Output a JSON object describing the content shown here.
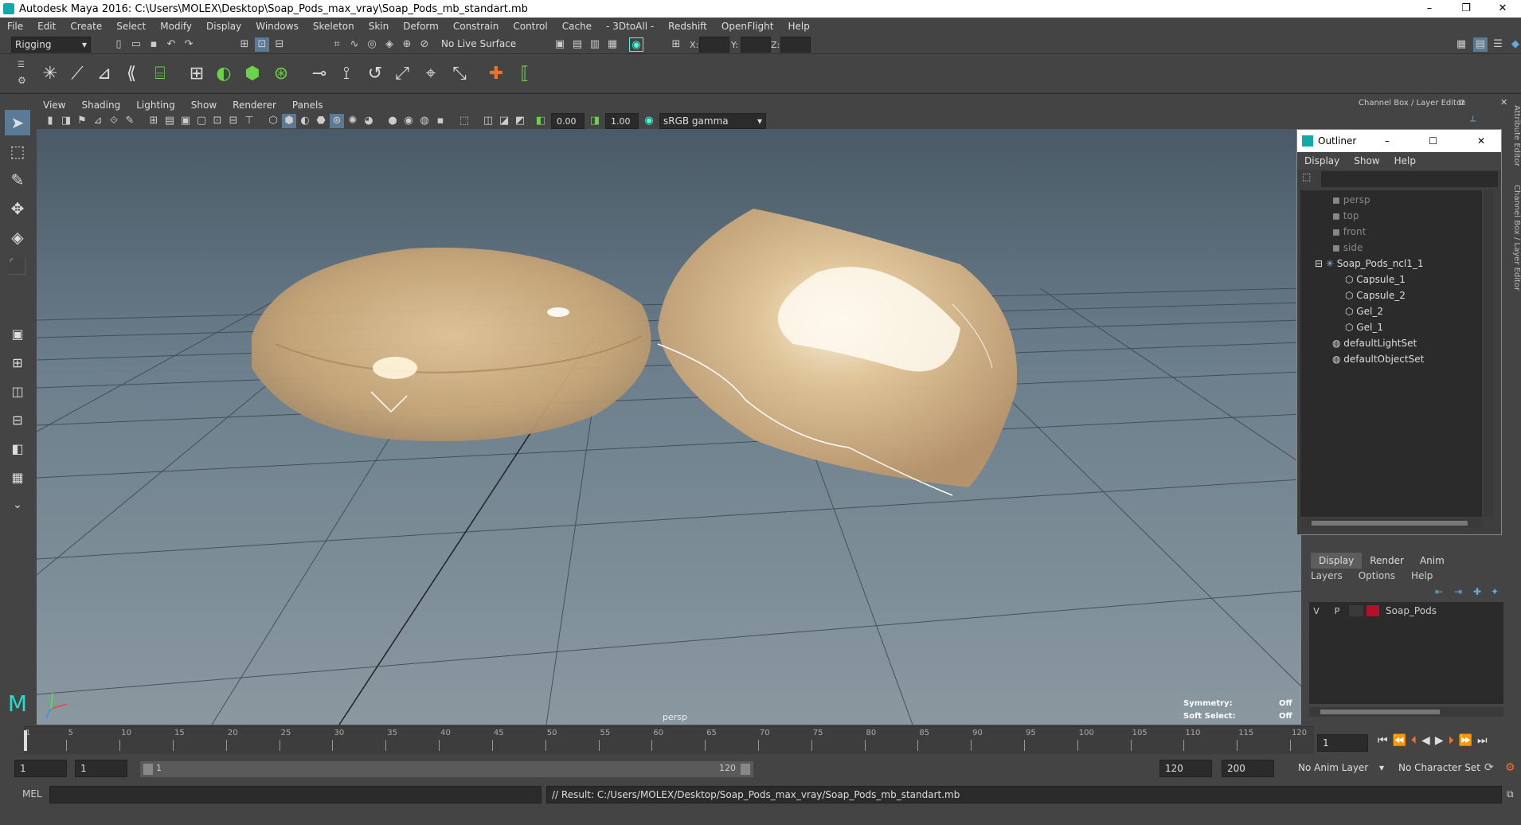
{
  "window": {
    "title": "Autodesk Maya 2016: C:\\Users\\MOLEX\\Desktop\\Soap_Pods_max_vray\\Soap_Pods_mb_standart.mb",
    "min": "–",
    "restore": "❐",
    "close": "✕"
  },
  "menubar": [
    "File",
    "Edit",
    "Create",
    "Select",
    "Modify",
    "Display",
    "Windows",
    "Skeleton",
    "Skin",
    "Deform",
    "Constrain",
    "Control",
    "Cache",
    "- 3DtoAll -",
    "Redshift",
    "OpenFlight",
    "Help"
  ],
  "statusline": {
    "mode": "Rigging",
    "live_surface": "No Live Surface",
    "x_label": "X:",
    "y_label": "Y:",
    "z_label": "Z:"
  },
  "viewport": {
    "menu": [
      "View",
      "Shading",
      "Lighting",
      "Show",
      "Renderer",
      "Panels"
    ],
    "exposure": "0.00",
    "gamma": "1.00",
    "colorspace": "sRGB gamma",
    "camera_label": "persp",
    "symmetry_label": "Symmetry:",
    "symmetry_value": "Off",
    "softselect_label": "Soft Select:",
    "softselect_value": "Off"
  },
  "channelbox": {
    "title": "Channel Box / Layer Editor",
    "side_tab_1": "Attribute Editor",
    "side_tab_2": "Channel Box / Layer Editor"
  },
  "outliner": {
    "title": "Outliner",
    "menu": [
      "Display",
      "Show",
      "Help"
    ],
    "items": [
      {
        "label": "persp",
        "dim": true
      },
      {
        "label": "top",
        "dim": true
      },
      {
        "label": "front",
        "dim": true
      },
      {
        "label": "side",
        "dim": true
      },
      {
        "label": "Soap_Pods_ncl1_1",
        "dim": false
      },
      {
        "label": "Capsule_1",
        "dim": false
      },
      {
        "label": "Capsule_2",
        "dim": false
      },
      {
        "label": "Gel_2",
        "dim": false
      },
      {
        "label": "Gel_1",
        "dim": false
      },
      {
        "label": "defaultLightSet",
        "dim": false
      },
      {
        "label": "defaultObjectSet",
        "dim": false
      }
    ]
  },
  "layer_editor": {
    "tabs": [
      "Display",
      "Render",
      "Anim"
    ],
    "menu": [
      "Layers",
      "Options",
      "Help"
    ],
    "layer": {
      "v": "V",
      "p": "P",
      "name": "Soap_Pods",
      "color": "#b3102a"
    }
  },
  "timeline": {
    "ticks": [
      "1",
      "5",
      "10",
      "15",
      "20",
      "25",
      "30",
      "35",
      "40",
      "45",
      "50",
      "55",
      "60",
      "65",
      "70",
      "75",
      "80",
      "85",
      "90",
      "95",
      "100",
      "105",
      "110",
      "115",
      "120"
    ],
    "current_frame": "1"
  },
  "range": {
    "start": "1",
    "anim_start": "1",
    "slider_start": "1",
    "slider_end": "120",
    "end": "120",
    "anim_end": "200",
    "anim_layer": "No Anim Layer",
    "character_set": "No Character Set"
  },
  "command": {
    "lang": "MEL",
    "result": "// Result: C:/Users/MOLEX/Desktop/Soap_Pods_max_vray/Soap_Pods_mb_standart.mb"
  },
  "colors": {
    "ui_bg": "#444444",
    "field_bg": "#2b2b2b",
    "accent_green": "#6cd24a",
    "layer_red": "#b3102a"
  }
}
